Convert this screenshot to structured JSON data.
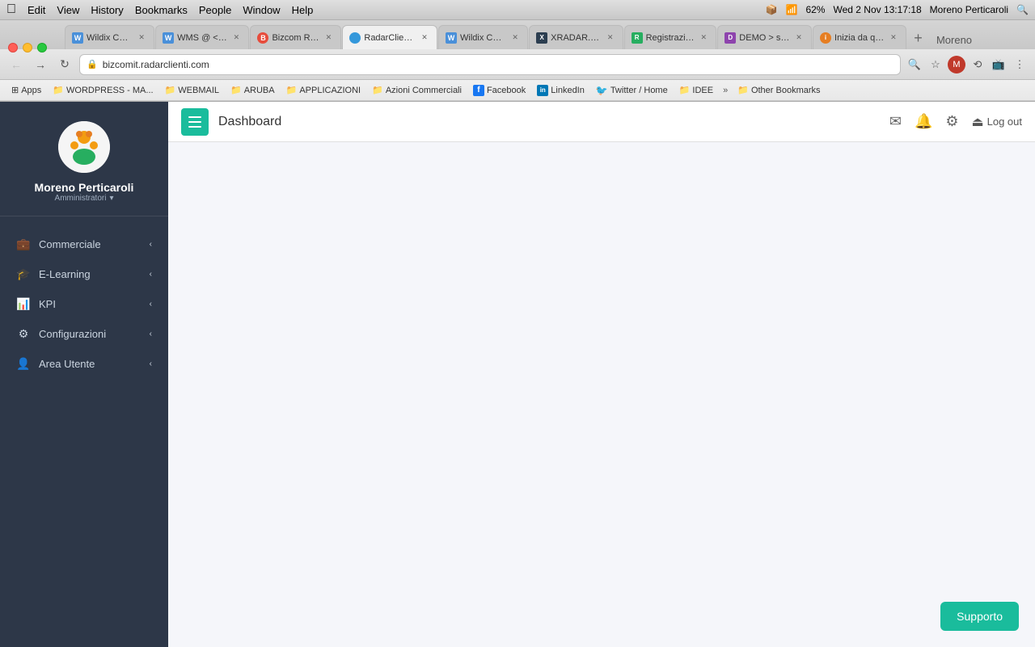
{
  "menubar": {
    "apple": "&#63743;",
    "items": [
      "Edit",
      "View",
      "History",
      "Bookmarks",
      "People",
      "Window",
      "Help"
    ],
    "right_info": "Wed 2 Nov  13:17:18",
    "user": "Moreno Perticaroli",
    "battery": "62%"
  },
  "tabs": [
    {
      "id": "tab1",
      "title": "Wildix Coll...",
      "favicon": "W",
      "favicon_type": "w",
      "active": false
    },
    {
      "id": "tab2",
      "title": "WMS @ <b...",
      "favicon": "W",
      "favicon_type": "w",
      "active": false
    },
    {
      "id": "tab3",
      "title": "Bizcom Ra...",
      "favicon": "B",
      "favicon_type": "b",
      "active": false
    },
    {
      "id": "tab4",
      "title": "RadarClient...",
      "favicon": "R",
      "favicon_type": "r",
      "active": true
    },
    {
      "id": "tab5",
      "title": "Wildix Coll...",
      "favicon": "W",
      "favicon_type": "w",
      "active": false
    },
    {
      "id": "tab6",
      "title": "XRADAR.C...",
      "favicon": "X",
      "favicon_type": "x",
      "active": false
    },
    {
      "id": "tab7",
      "title": "Registrazio...",
      "favicon": "Reg",
      "favicon_type": "reg",
      "active": false
    },
    {
      "id": "tab8",
      "title": "DEMO > su...",
      "favicon": "D",
      "favicon_type": "demo",
      "active": false
    },
    {
      "id": "tab9",
      "title": "Inizia da qu...",
      "favicon": "i",
      "favicon_type": "i",
      "active": false
    }
  ],
  "addressbar": {
    "url": "bizcomit.radarclienti.com",
    "protocol": "https"
  },
  "bookmarks": [
    {
      "label": "Apps",
      "icon": "🔲",
      "type": "apps"
    },
    {
      "label": "WORDPRESS - MA...",
      "icon": "📁",
      "type": "folder"
    },
    {
      "label": "WEBMAIL",
      "icon": "📁",
      "type": "folder"
    },
    {
      "label": "ARUBA",
      "icon": "📁",
      "type": "folder"
    },
    {
      "label": "APPLICAZIONI",
      "icon": "📁",
      "type": "folder"
    },
    {
      "label": "Azioni Commerciali",
      "icon": "📁",
      "type": "folder"
    },
    {
      "label": "Facebook",
      "icon": "f",
      "type": "facebook"
    },
    {
      "label": "LinkedIn",
      "icon": "in",
      "type": "linkedin"
    },
    {
      "label": "Twitter / Home",
      "icon": "🐦",
      "type": "twitter"
    },
    {
      "label": "IDEE",
      "icon": "📁",
      "type": "folder"
    },
    {
      "label": "Other Bookmarks",
      "icon": "📁",
      "type": "folder"
    }
  ],
  "sidebar": {
    "user_name": "Moreno Perticaroli",
    "user_role": "Amministratori",
    "nav_items": [
      {
        "id": "commerciale",
        "label": "Commerciale",
        "icon": "💼",
        "has_arrow": true
      },
      {
        "id": "elearning",
        "label": "E-Learning",
        "icon": "🎓",
        "has_arrow": true
      },
      {
        "id": "kpi",
        "label": "KPI",
        "icon": "📊",
        "has_arrow": true
      },
      {
        "id": "configurazioni",
        "label": "Configurazioni",
        "icon": "⚙️",
        "has_arrow": true
      },
      {
        "id": "area-utente",
        "label": "Area Utente",
        "icon": "👤",
        "has_arrow": true
      }
    ]
  },
  "dashboard": {
    "title": "Dashboard",
    "header_icons": {
      "email": "✉",
      "bell": "🔔",
      "settings": "⚙"
    },
    "logout_label": "Log out",
    "support_label": "Supporto"
  }
}
